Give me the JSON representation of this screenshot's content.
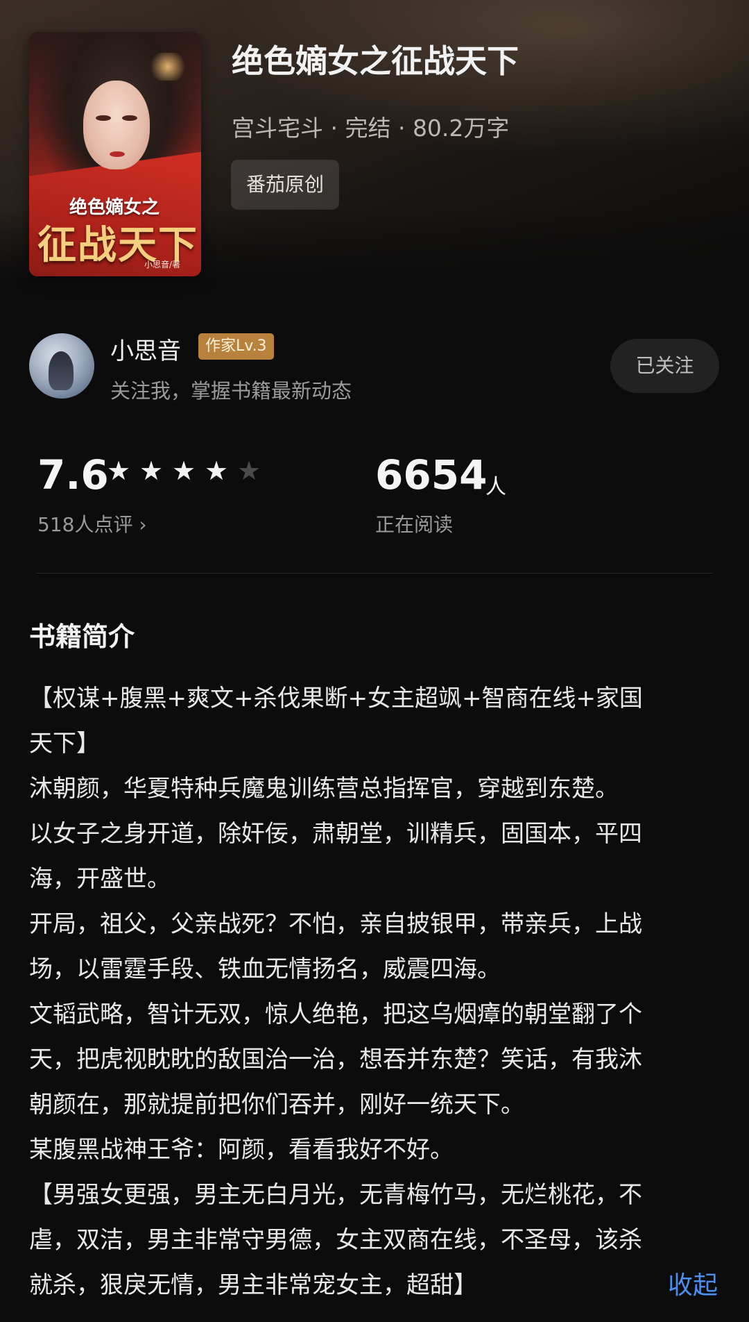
{
  "book": {
    "title": "绝色嫡女之征战天下",
    "meta": "宫斗宅斗 · 完结 · 80.2万字",
    "tag": "番茄原创",
    "cover": {
      "title_small": "绝色嫡女之",
      "title_big": "征战天下",
      "author": "小思音/著"
    }
  },
  "author": {
    "name": "小思音",
    "badge": "作家Lv.3",
    "subtitle": "关注我，掌握书籍最新动态",
    "follow_label": "已关注"
  },
  "stats": {
    "score": "7.6",
    "rating_stars": 4,
    "rating_max": 5,
    "reviews": "518人点评 ›",
    "readers": "6654",
    "readers_unit": "人",
    "readers_label": "正在阅读"
  },
  "intro": {
    "heading": "书籍简介",
    "text": "【权谋+腹黑+爽文+杀伐果断+女主超飒+智商在线+家国\n天下】\n沐朝颜，华夏特种兵魔鬼训练营总指挥官，穿越到东楚。\n以女子之身开道，除奸佞，肃朝堂，训精兵，固国本，平四\n海，开盛世。\n开局，祖父，父亲战死？不怕，亲自披银甲，带亲兵，上战\n场，以雷霆手段、铁血无情扬名，威震四海。\n文韬武略，智计无双，惊人绝艳，把这乌烟瘴的朝堂翻了个\n天，把虎视眈眈的敌国治一治，想吞并东楚？笑话，有我沐\n朝颜在，那就提前把你们吞并，刚好一统天下。\n某腹黑战神王爷：阿颜，看看我好不好。\n【男强女更强，男主无白月光，无青梅竹马，无烂桃花，不\n虐，双洁，男主非常守男德，女主双商在线，不圣母，该杀\n就杀，狠戾无情，男主非常宠女主，超甜】",
    "collapse_label": "收起"
  }
}
